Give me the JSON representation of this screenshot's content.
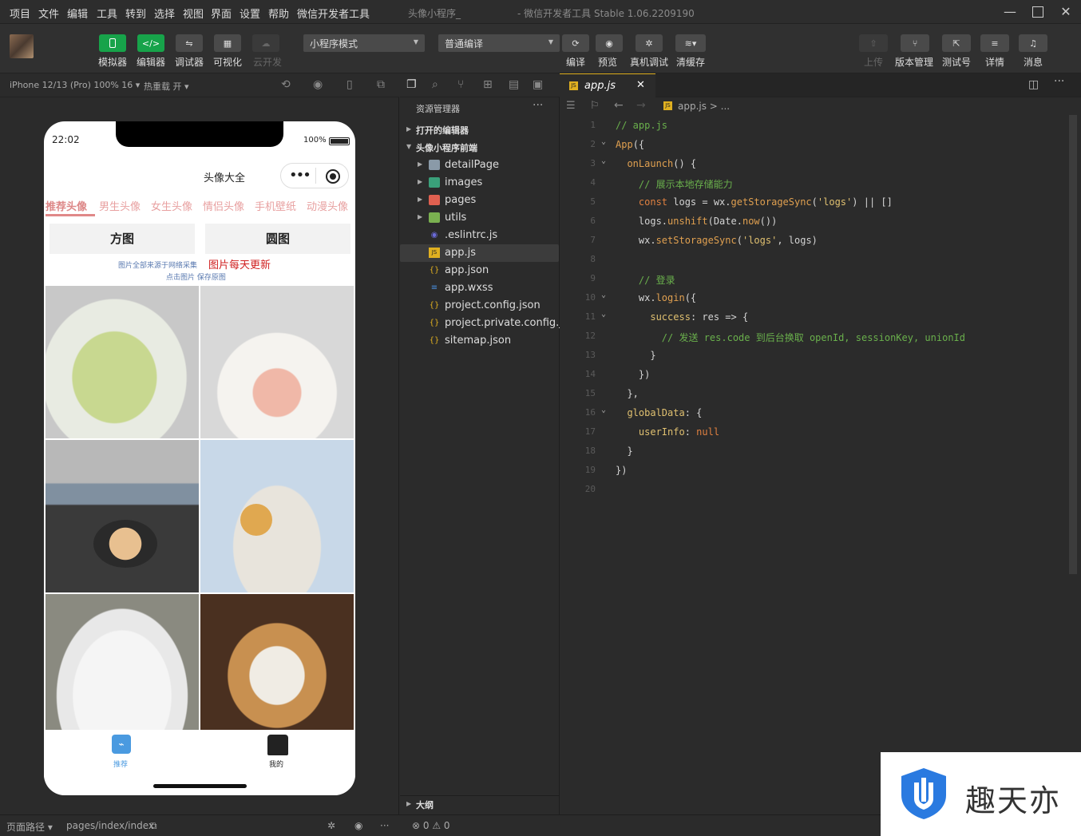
{
  "menubar": {
    "items": [
      "项目",
      "文件",
      "编辑",
      "工具",
      "转到",
      "选择",
      "视图",
      "界面",
      "设置",
      "帮助",
      "微信开发者工具"
    ],
    "project_title": "头像小程序_",
    "app_title": "- 微信开发者工具 Stable 1.06.2209190"
  },
  "toolbar": {
    "left_buttons": [
      {
        "label": "模拟器",
        "icon": "phone-icon",
        "style": "green"
      },
      {
        "label": "编辑器",
        "icon": "code-icon",
        "style": "green"
      },
      {
        "label": "调试器",
        "icon": "debug-icon",
        "style": "gray"
      },
      {
        "label": "可视化",
        "icon": "layout-icon",
        "style": "gray"
      },
      {
        "label": "云开发",
        "icon": "cloud-icon",
        "style": "dim"
      }
    ],
    "mode_select": "小程序模式",
    "compile_select": "普通编译",
    "mid_buttons": [
      {
        "label": "编译",
        "icon": "refresh-icon"
      },
      {
        "label": "预览",
        "icon": "eye-icon"
      },
      {
        "label": "真机调试",
        "icon": "bug-icon"
      },
      {
        "label": "清缓存",
        "icon": "layers-icon"
      }
    ],
    "right_buttons": [
      {
        "label": "上传",
        "icon": "upload-icon",
        "dim": true
      },
      {
        "label": "版本管理",
        "icon": "branch-icon",
        "dim": false
      },
      {
        "label": "测试号",
        "icon": "external-icon",
        "dim": false
      },
      {
        "label": "详情",
        "icon": "menu-icon",
        "dim": false
      },
      {
        "label": "消息",
        "icon": "bell-icon",
        "dim": false
      }
    ]
  },
  "simulator": {
    "device": "iPhone 12/13 (Pro) 100% 16 ▾",
    "hot_reload": "热重载 开 ▾",
    "status_time": "22:02",
    "battery": "100%",
    "nav_title": "头像大全",
    "categories": [
      "推荐头像",
      "男生头像",
      "女生头像",
      "情侣头像",
      "手机壁纸",
      "动漫头像"
    ],
    "active_category": 0,
    "shape_buttons": [
      "方图",
      "圆图"
    ],
    "notice_small": "图片全部来源于网络采集",
    "notice_big": "图片每天更新",
    "notice_tip": "点击图片 保存原图",
    "tabbar": [
      {
        "label": "推荐",
        "icon": "chart-icon"
      },
      {
        "label": "我的",
        "icon": "shirt-icon"
      }
    ]
  },
  "explorer": {
    "title": "资源管理器",
    "open_editors": "打开的编辑器",
    "project": "头像小程序前端",
    "files": [
      {
        "name": "detailPage",
        "type": "folder",
        "color": "#8a9aa8",
        "icon": "folder-icon"
      },
      {
        "name": "images",
        "type": "folder",
        "color": "#3aa07a",
        "icon": "folder-images-icon"
      },
      {
        "name": "pages",
        "type": "folder",
        "color": "#e06050",
        "icon": "folder-pages-icon"
      },
      {
        "name": "utils",
        "type": "folder",
        "color": "#7ab050",
        "icon": "folder-utils-icon"
      },
      {
        "name": ".eslintrc.js",
        "type": "file",
        "color": "#6a6ad8",
        "icon": "eslint-icon"
      },
      {
        "name": "app.js",
        "type": "file",
        "color": "#e0b020",
        "icon": "js-icon"
      },
      {
        "name": "app.json",
        "type": "file",
        "color": "#e0b020",
        "icon": "json-icon"
      },
      {
        "name": "app.wxss",
        "type": "file",
        "color": "#4a90e0",
        "icon": "css-icon"
      },
      {
        "name": "project.config.json",
        "type": "file",
        "color": "#e0b020",
        "icon": "json-icon"
      },
      {
        "name": "project.private.config.js...",
        "type": "file",
        "color": "#e0b020",
        "icon": "json-icon"
      },
      {
        "name": "sitemap.json",
        "type": "file",
        "color": "#e0b020",
        "icon": "json-icon"
      }
    ],
    "selected": 5,
    "outline": "大纲"
  },
  "editor": {
    "tab": "app.js",
    "breadcrumb": "app.js > ...",
    "lines": [
      "// app.js",
      "App({",
      "  onLaunch() {",
      "    // 展示本地存储能力",
      "    const logs = wx.getStorageSync('logs') || []",
      "    logs.unshift(Date.now())",
      "    wx.setStorageSync('logs', logs)",
      "",
      "    // 登录",
      "    wx.login({",
      "      success: res => {",
      "        // 发送 res.code 到后台换取 openId, sessionKey, unionId",
      "      }",
      "    })",
      "  },",
      "  globalData: {",
      "    userInfo: null",
      "  }",
      "})",
      ""
    ]
  },
  "status": {
    "path_label": "页面路径 ▾",
    "path": "pages/index/index",
    "errors": "⊗ 0 ⚠ 0"
  },
  "watermark": "趣天亦"
}
